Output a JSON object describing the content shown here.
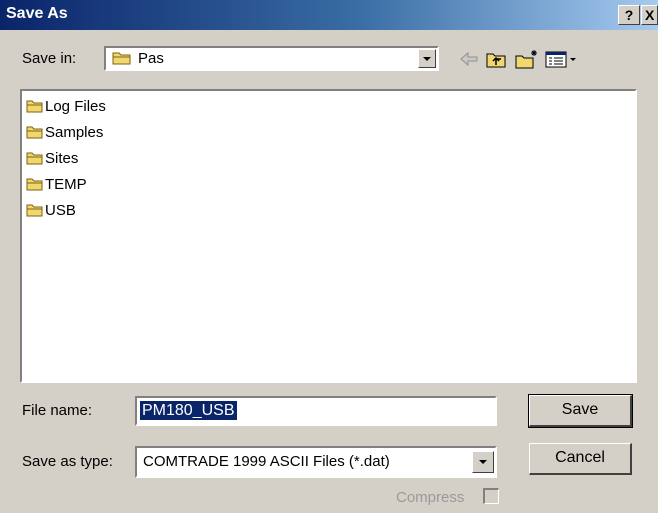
{
  "window": {
    "title": "Save As",
    "help_label": "?",
    "close_label": "X"
  },
  "save_in": {
    "label": "Save in:",
    "value": "Pas"
  },
  "toolbar": {
    "icons": [
      "back-arrow-icon",
      "up-folder-icon",
      "new-folder-icon",
      "views-menu-icon"
    ]
  },
  "files": [
    {
      "name": "Log Files",
      "icon": "folder-icon"
    },
    {
      "name": "Samples",
      "icon": "folder-icon"
    },
    {
      "name": "Sites",
      "icon": "folder-icon"
    },
    {
      "name": "TEMP",
      "icon": "folder-icon"
    },
    {
      "name": "USB",
      "icon": "folder-icon"
    }
  ],
  "file_name": {
    "label": "File name:",
    "value": "PM180_USB"
  },
  "save_as_type": {
    "label": "Save as type:",
    "value": "COMTRADE 1999 ASCII Files (*.dat)"
  },
  "buttons": {
    "save": "Save",
    "cancel": "Cancel"
  },
  "compress": {
    "label": "Compress",
    "checked": false,
    "enabled": false
  },
  "colors": {
    "title_start": "#0a246a",
    "title_end": "#a6caf0",
    "face": "#d4d0c8",
    "selection": "#0a246a",
    "folder": "#f0d770"
  }
}
